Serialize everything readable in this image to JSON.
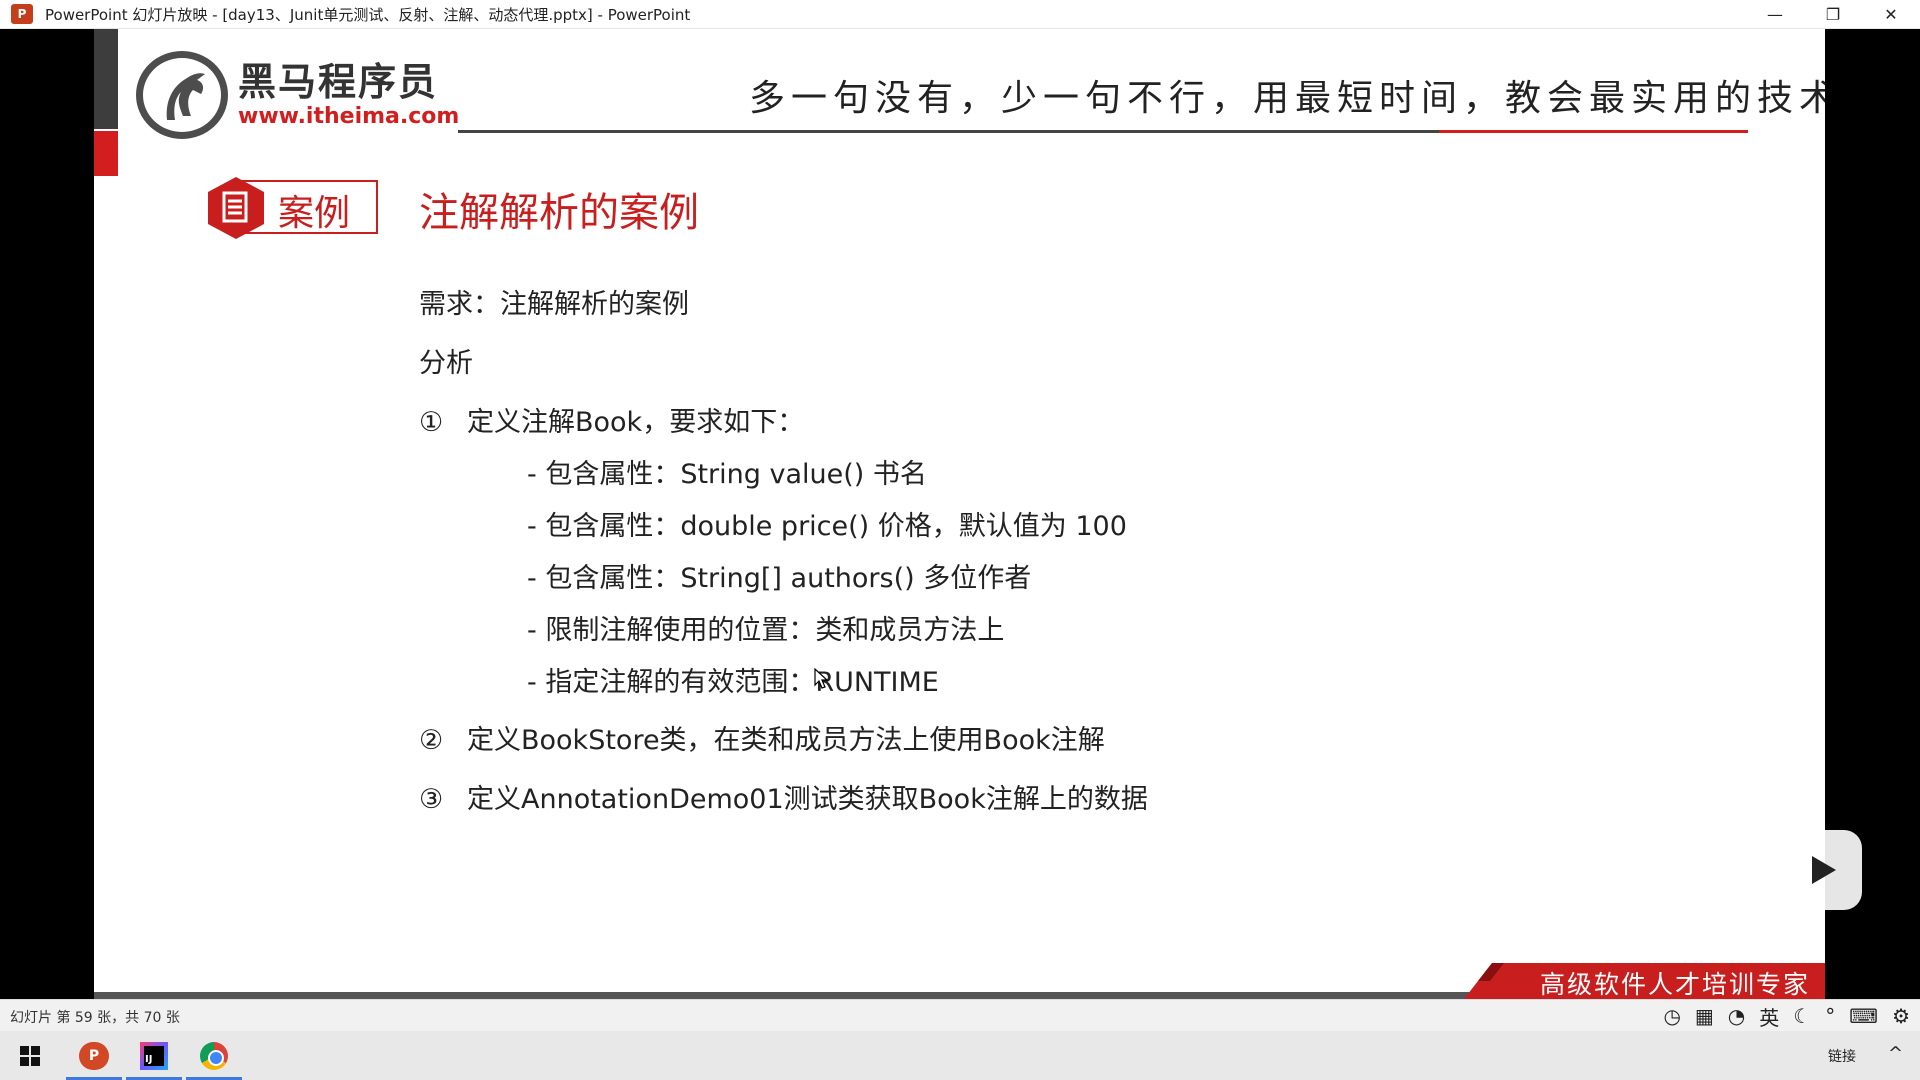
{
  "window": {
    "title": "PowerPoint 幻灯片放映 - [day13、Junit单元测试、反射、注解、动态代理.pptx] - PowerPoint",
    "app_icon": "P",
    "minimize_glyph": "—",
    "restore_glyph": "❐",
    "close_glyph": "✕"
  },
  "slide": {
    "logo_cn": "黑马程序员",
    "logo_url": "www.itheima.com",
    "slogan": "多一句没有，少一句不行，用最短时间，教会最实用的技术！",
    "badge": "案例",
    "title": "注解解析的案例",
    "lines": [
      "需求：注解解析的案例",
      "分析",
      "定义注解Book，要求如下：",
      "- 包含属性：String value()   书名",
      "- 包含属性：double price()  价格，默认值为 100",
      "- 包含属性：String[] authors() 多位作者",
      "- 限制注解使用的位置：类和成员方法上",
      "- 指定注解的有效范围：RUNTIME",
      "定义BookStore类，在类和成员方法上使用Book注解",
      "定义AnnotationDemo01测试类获取Book注解上的数据"
    ],
    "nums": [
      "①",
      "②",
      "③"
    ],
    "footer_tag": "高级软件人才培训专家"
  },
  "statusbar": {
    "text": "幻灯片 第 59 张，共 70 张",
    "ime_lang": "英"
  },
  "taskbar": {
    "ppt_label": "P",
    "idea_label": "IJ",
    "tray_link": "链接",
    "tray_caret": "^"
  },
  "colors": {
    "accent_red": "#c81e1e",
    "text_dark": "#222222",
    "bar_gray": "#3d3d3d"
  }
}
